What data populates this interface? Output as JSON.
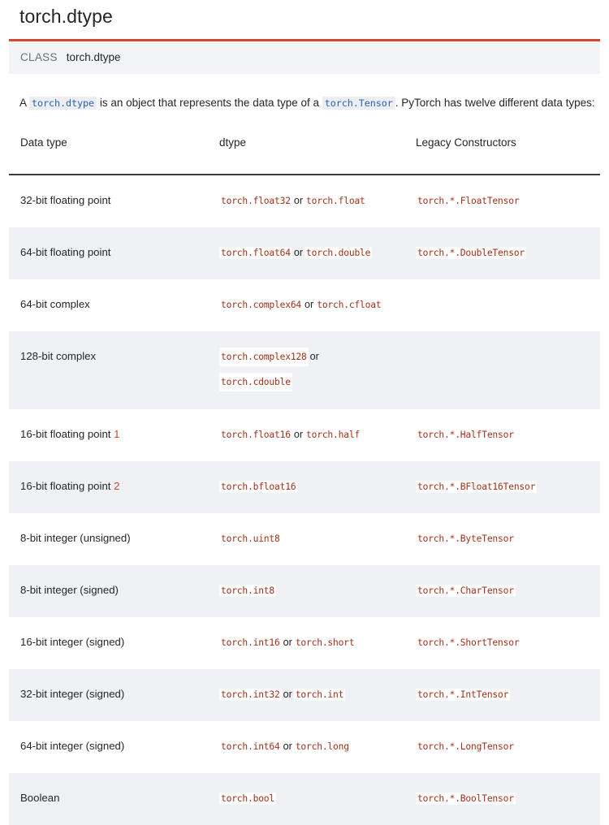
{
  "page": {
    "title": "torch.dtype"
  },
  "signature": {
    "keyword": "CLASS",
    "name": "torch.dtype",
    "accent_color": "#d9472b",
    "background": "#f3f4f7"
  },
  "intro": {
    "text_before": "A",
    "code1": "torch.dtype",
    "text_middle": "is an object that represents the data type of a",
    "code2": "torch.Tensor",
    "text_after": ". PyTorch has twelve different data types:",
    "link_color": "#2962b0"
  },
  "table": {
    "headers": [
      "Data type",
      "dtype",
      "Legacy Constructors"
    ],
    "literal_color": "#a23119",
    "stripe_color": "#f0f1f5",
    "rows": [
      {
        "data_type": "32-bit floating point",
        "footnote": "",
        "dtype": [
          "torch.float32",
          "torch.float"
        ],
        "joiner": "or",
        "legacy": "torch.*.FloatTensor"
      },
      {
        "data_type": "64-bit floating point",
        "footnote": "",
        "dtype": [
          "torch.float64",
          "torch.double"
        ],
        "joiner": "or",
        "legacy": "torch.*.DoubleTensor"
      },
      {
        "data_type": "64-bit complex",
        "footnote": "",
        "dtype": [
          "torch.complex64",
          "torch.cfloat"
        ],
        "joiner": "or",
        "legacy": ""
      },
      {
        "data_type": "128-bit complex",
        "footnote": "",
        "dtype": [
          "torch.complex128",
          "torch.cdouble"
        ],
        "joiner": "or",
        "legacy": "",
        "wrap": true
      },
      {
        "data_type": "16-bit floating point",
        "footnote": "1",
        "dtype": [
          "torch.float16",
          "torch.half"
        ],
        "joiner": "or",
        "legacy": "torch.*.HalfTensor"
      },
      {
        "data_type": "16-bit floating point",
        "footnote": "2",
        "dtype": [
          "torch.bfloat16"
        ],
        "joiner": "",
        "legacy": "torch.*.BFloat16Tensor"
      },
      {
        "data_type": "8-bit integer (unsigned)",
        "footnote": "",
        "dtype": [
          "torch.uint8"
        ],
        "joiner": "",
        "legacy": "torch.*.ByteTensor"
      },
      {
        "data_type": "8-bit integer (signed)",
        "footnote": "",
        "dtype": [
          "torch.int8"
        ],
        "joiner": "",
        "legacy": "torch.*.CharTensor"
      },
      {
        "data_type": "16-bit integer (signed)",
        "footnote": "",
        "dtype": [
          "torch.int16",
          "torch.short"
        ],
        "joiner": "or",
        "legacy": "torch.*.ShortTensor"
      },
      {
        "data_type": "32-bit integer (signed)",
        "footnote": "",
        "dtype": [
          "torch.int32",
          "torch.int"
        ],
        "joiner": "or",
        "legacy": "torch.*.IntTensor"
      },
      {
        "data_type": "64-bit integer (signed)",
        "footnote": "",
        "dtype": [
          "torch.int64",
          "torch.long"
        ],
        "joiner": "or",
        "legacy": "torch.*.LongTensor"
      },
      {
        "data_type": "Boolean",
        "footnote": "",
        "dtype": [
          "torch.bool"
        ],
        "joiner": "",
        "legacy": "torch.*.BoolTensor"
      }
    ]
  }
}
